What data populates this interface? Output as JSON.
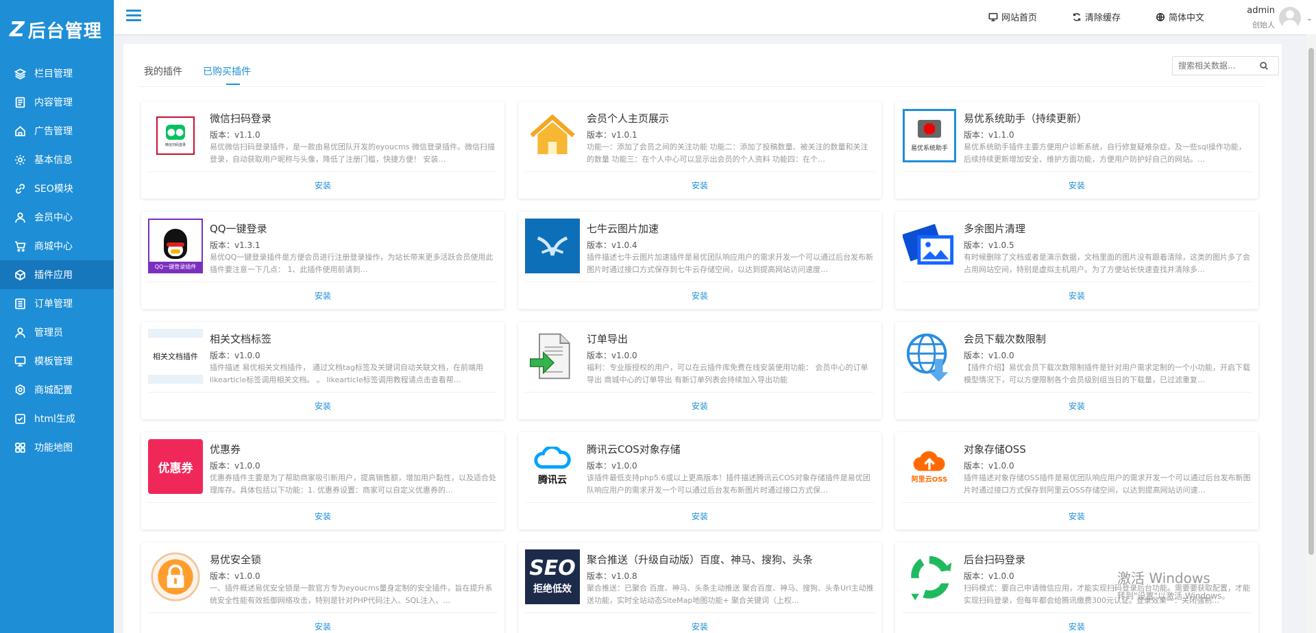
{
  "app": {
    "logo_text": "后台管理"
  },
  "sidebar": {
    "items": [
      {
        "label": "栏目管理",
        "icon": "layers-icon"
      },
      {
        "label": "内容管理",
        "icon": "document-icon"
      },
      {
        "label": "广告管理",
        "icon": "home-icon"
      },
      {
        "label": "基本信息",
        "icon": "gear-icon"
      },
      {
        "label": "SEO模块",
        "icon": "link-icon"
      },
      {
        "label": "会员中心",
        "icon": "user-icon"
      },
      {
        "label": "商城中心",
        "icon": "cart-icon"
      },
      {
        "label": "插件应用",
        "icon": "cube-icon",
        "active": true
      },
      {
        "label": "订单管理",
        "icon": "list-icon"
      },
      {
        "label": "管理员",
        "icon": "admin-icon"
      },
      {
        "label": "模板管理",
        "icon": "monitor-icon"
      },
      {
        "label": "商城配置",
        "icon": "settings-icon"
      },
      {
        "label": "html生成",
        "icon": "check-square-icon"
      },
      {
        "label": "功能地图",
        "icon": "grid-icon"
      }
    ]
  },
  "header": {
    "site_home": "网站首页",
    "clear_cache": "清除缓存",
    "language": "简体中文",
    "user_name": "admin",
    "user_role": "创始人"
  },
  "tabs": [
    {
      "label": "我的插件",
      "active": false
    },
    {
      "label": "已购买插件",
      "active": true
    }
  ],
  "search": {
    "placeholder": "搜索相关数据..."
  },
  "install_label": "安装",
  "plugins": [
    {
      "title": "微信扫码登录",
      "version": "版本：v1.1.0",
      "desc": "易优微信扫码登录插件，是一款由易优团队开发的eyoucms 微信登录插件。微信扫描登录，自动获取用户昵称与头像，降低了注册门槛，快捷方便！ 安装…",
      "thumb": "wechat",
      "thumb_text": "微信扫码登录"
    },
    {
      "title": "会员个人主页展示",
      "version": "版本：v1.0.1",
      "desc": "功能一：添加了会员之间的关注功能 功能二：添加了投稿数量、被关注的数量和关注的数量 功能三：在个人中心可以显示出会员的个人资料 功能四：在个…",
      "thumb": "house"
    },
    {
      "title": "易优系统助手（持续更新）",
      "version": "版本：v1.1.0",
      "desc": "易优系统助手插件主要方便用户诊断系统，自行修复疑难杂症，及一些sql操作功能，后续持续更新增加安全、维护方面功能，方便用户防护好自己的网站。…",
      "thumb": "medkit",
      "thumb_text": "易优系统助手"
    },
    {
      "title": "QQ一键登录",
      "version": "版本：v1.3.1",
      "desc": "易优QQ一键登录插件是方便会员进行注册登录操作，为站长带来更多活跃会员使用此插件要注意一下几点： 1、此插件使用前请到…",
      "thumb": "qq",
      "thumb_text": "QQ一键登录插件"
    },
    {
      "title": "七牛云图片加速",
      "version": "版本：v1.0.4",
      "desc": "插件描述七牛云图片加速插件是易优团队响应用户的需求开发一个可以通过后台发布新图片时通过接口方式保存到七牛云存储空间，以达到提高网站访问速度…",
      "thumb": "qiniu"
    },
    {
      "title": "多余图片清理",
      "version": "版本：v1.0.5",
      "desc": "有时候删除了文档或者是演示数据，文档里面的图片没有跟着清除，这类的图片多了会占用网站空间，特别是虚拟主机用户。为了方便站长快速查找并清除多…",
      "thumb": "images"
    },
    {
      "title": "相关文档标签",
      "version": "版本：v1.0.0",
      "desc": "插件描述 易优相关文档插件， 通过文档tag标签及关键词自动关联文档，在前端用likearticle标签调用相关文档。 。 likearticle标签调用教程请点击查看帮…",
      "thumb": "doctag",
      "thumb_text": "相关文档插件"
    },
    {
      "title": "订单导出",
      "version": "版本：v1.0.0",
      "desc": "福利：专业版授权的用户，可以在云插件库免费在线安装使用功能： 会员中心的订单导出 商城中心的订单导出 有新订单列表会持续加入导出功能",
      "thumb": "export"
    },
    {
      "title": "会员下载次数限制",
      "version": "版本：v1.0.0",
      "desc": "【插件介绍】易优会员下载次数限制插件是针对用户需求定制的一个小功能，开启下载模型情况下，可以方便限制各个会员级别组当日的下载量，已过滤重复…",
      "thumb": "globe"
    },
    {
      "title": "优惠券",
      "version": "版本：v1.0.0",
      "desc": "优惠券插件主要是为了帮助商家吸引新用户，提高销售额，增加用户黏性，以及适合处理库存。具体包括以下功能：1. 优惠券设置：商家可以自定义优惠券的…",
      "thumb": "coupon",
      "thumb_text": "优惠券"
    },
    {
      "title": "腾讯云COS对象存储",
      "version": "版本：v1.0.0",
      "desc": "该插件最低支持php5.6或以上更高版本！插件描述腾讯云COS对象存储插件是易优团队响应用户的需求开发一个可以通过后台发布新图片时通过接口方式保…",
      "thumb": "tencent",
      "thumb_text": "腾讯云"
    },
    {
      "title": "对象存储OSS",
      "version": "版本：v1.0.0",
      "desc": "插件描述对象存储OSS插件是易优团队响应用户的需求开发一个可以通过后台发布新图片时通过接口方式保存到阿里云OSS存储空间，以达到提高网站访问速…",
      "thumb": "aliyun",
      "thumb_text": "阿里云OSS"
    },
    {
      "title": "易优安全锁",
      "version": "版本：v1.0.0",
      "desc": "一、插件概述易优安全锁是一款官方专为eyoucms量身定制的安全插件，旨在提升系统安全性能有效抵御网络攻击，特别是针对PHP代码注入、SQL注入、…",
      "thumb": "lock"
    },
    {
      "title": "聚合推送（升级自动版）百度、神马、搜狗、头条",
      "version": "版本：v1.0.8",
      "desc": "聚合推送：已聚合 百度、神马、头条主动推送 聚合百度、神马、搜狗、头条Url主动推送功能，实时全站动态SiteMap地图功能+ 聚合关键词（上权…",
      "thumb": "seo",
      "thumb_text": "拒绝低效"
    },
    {
      "title": "后台扫码登录",
      "version": "版本：v1.0.0",
      "desc": "扫码模式：要自己申请微信应用，才能实现扫码登录后台功能。需要要获取配置，才能实现扫码登录，但每年都会给腾讯缴费300元认证。登录效果一：关闭强制…",
      "thumb": "scan"
    }
  ],
  "watermark": {
    "activate_title": "激活 Windows",
    "activate_sub": "转到\"设置\"以激活 Windows。"
  }
}
